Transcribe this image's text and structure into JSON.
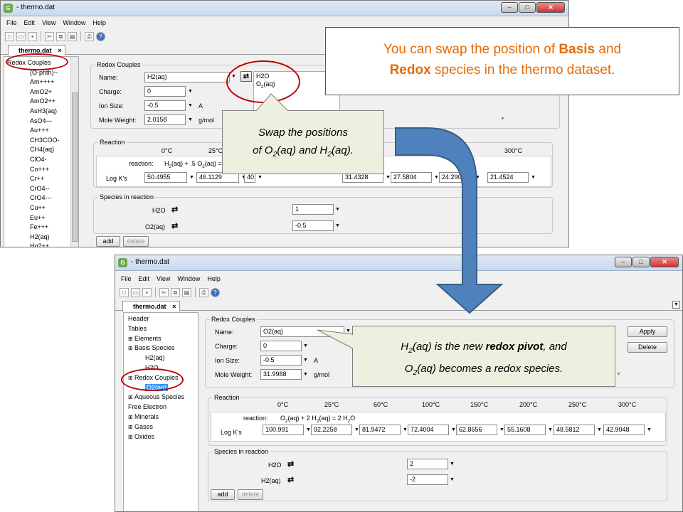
{
  "top_window": {
    "title": "- thermo.dat",
    "menu": [
      "File",
      "Edit",
      "View",
      "Window",
      "Help"
    ],
    "tab": "thermo.dat",
    "tree_items": [
      "Redox Couples",
      "(O-phth)--",
      "Am++++",
      "AmO2+",
      "AmO2++",
      "AsH3(aq)",
      "AsO4---",
      "Au+++",
      "CH3COO-",
      "CH4(aq)",
      "ClO4-",
      "Co+++",
      "Cr++",
      "CrO4--",
      "CrO4---",
      "Cu++",
      "Eu++",
      "Fe+++",
      "H2(aq)",
      "Hg2++"
    ],
    "group_redox": "Redox Couples",
    "name_label": "Name:",
    "name_value": "H2(aq)",
    "list_items": [
      "H2O",
      "O2(aq)"
    ],
    "charge_label": "Charge:",
    "charge_value": "0",
    "ion_label": "Ion Size:",
    "ion_value": "-0.5",
    "ion_unit": "A",
    "mw_label": "Mole Weight:",
    "mw_value": "2.0158",
    "mw_unit": "g/mol",
    "group_reaction": "Reaction",
    "temps": [
      "0°C",
      "25°C",
      "300°C"
    ],
    "reaction_label": "reaction:",
    "reaction_text": "H2(aq) + .5 O2(aq) = ",
    "logk_label": "Log K's",
    "logk": [
      "50.4955",
      "46.1129",
      "40.",
      "31.4328",
      "27.5804",
      "24.290",
      "21.4524"
    ],
    "group_species": "Species in reaction",
    "species": [
      {
        "name": "H2O",
        "coef": "1"
      },
      {
        "name": "O2(aq)",
        "coef": "-0.5"
      }
    ],
    "add": "add",
    "delete": "delete"
  },
  "bottom_window": {
    "title": "- thermo.dat",
    "menu": [
      "File",
      "Edit",
      "View",
      "Window",
      "Help"
    ],
    "tab": "thermo.dat",
    "tree_items": [
      "Header",
      "Tables",
      "Elements",
      "Basis Species",
      "H2(aq)",
      "H2O",
      "Redox Couples",
      "O2(aq)",
      "Aqueous Species",
      "Free Electron",
      "Minerals",
      "Gases",
      "Oxides"
    ],
    "group_redox": "Redox Couples",
    "name_label": "Name:",
    "name_value": "O2(aq)",
    "charge_label": "Charge:",
    "charge_value": "0",
    "ion_label": "Ion Size:",
    "ion_value": "-0.5",
    "ion_unit": "A",
    "mw_label": "Mole Weight:",
    "mw_value": "31.9988",
    "mw_unit": "g/mol",
    "apply": "Apply",
    "delete_btn": "Delete",
    "group_reaction": "Reaction",
    "temps": [
      "0°C",
      "25°C",
      "60°C",
      "100°C",
      "150°C",
      "200°C",
      "250°C",
      "300°C"
    ],
    "reaction_label": "reaction:",
    "reaction_text": "O2(aq) + 2 H2(aq) = 2 H2O",
    "logk_label": "Log K's",
    "logk": [
      "100.991",
      "92.2258",
      "81.9472",
      "72.4004",
      "62.8656",
      "55.1608",
      "48.5812",
      "42.9048"
    ],
    "group_species": "Species in reaction",
    "species": [
      {
        "name": "H2O",
        "coef": "2"
      },
      {
        "name": "H2(aq)",
        "coef": "-2"
      }
    ],
    "add": "add",
    "delete": "delete"
  },
  "annotations": {
    "headline_part1": "You can swap the position of ",
    "headline_basis": "Basis",
    "headline_and": " and",
    "headline_redox": "Redox",
    "headline_part2": " species in the thermo dataset.",
    "callout1_a": "Swap the positions",
    "callout1_b_pre": "of O",
    "callout1_b_mid": "(aq) and H",
    "callout1_b_end": "(aq).",
    "callout2_a_pre": "H",
    "callout2_a_mid": "(aq) is the new ",
    "callout2_a_bold": "redox pivot",
    "callout2_a_end": ", and",
    "callout2_b_pre": "O",
    "callout2_b_end": "(aq) becomes a redox species.",
    "sub2": "2"
  },
  "colors": {
    "callout_bg": "#ebf1de",
    "highlight_oval": "#c00000",
    "headline": "#e36c09",
    "arrow": "#4f81bd",
    "selection": "#3399ff"
  },
  "icons": [
    "swap-icon",
    "new-file-icon",
    "open-folder-icon",
    "save-icon",
    "cut-icon",
    "copy-icon",
    "paste-icon",
    "print-icon",
    "help-icon"
  ]
}
